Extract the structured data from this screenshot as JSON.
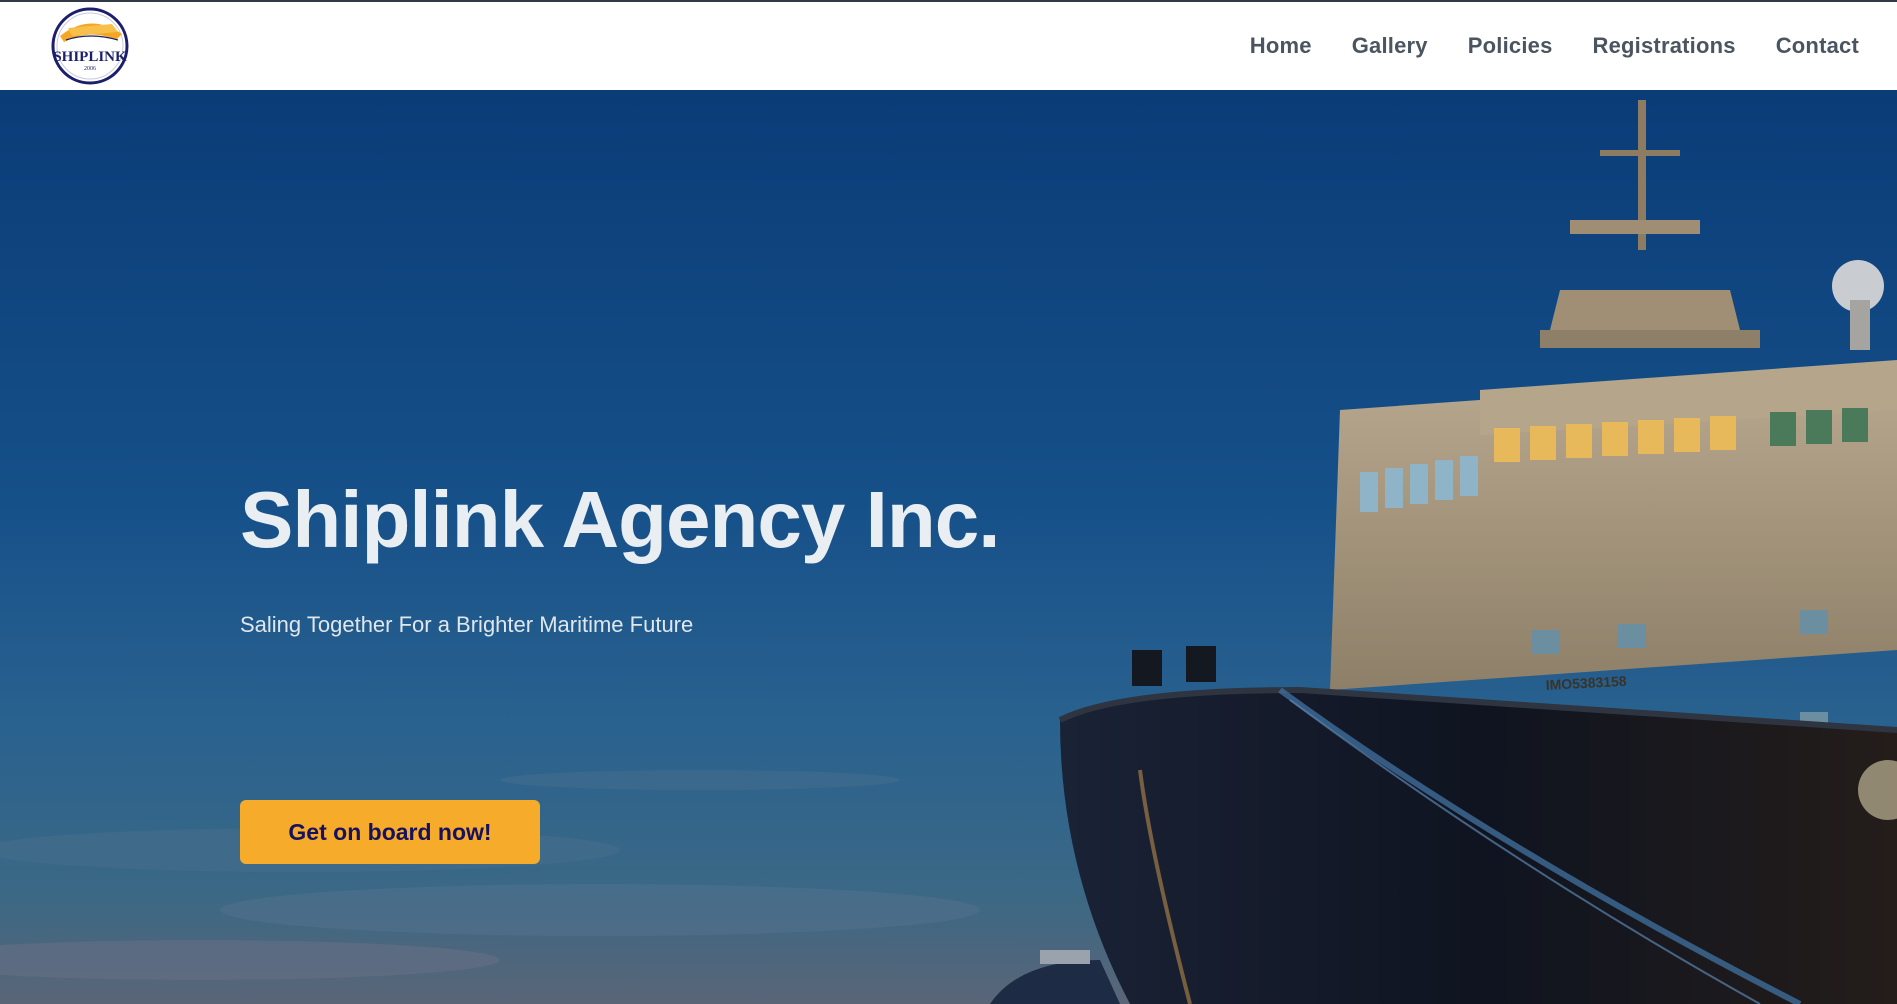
{
  "brand": {
    "logo_text": "SHIPLINK",
    "logo_year": "2006"
  },
  "nav": {
    "items": [
      {
        "label": "Home"
      },
      {
        "label": "Gallery"
      },
      {
        "label": "Policies"
      },
      {
        "label": "Registrations"
      },
      {
        "label": "Contact"
      }
    ]
  },
  "hero": {
    "title": "Shiplink Agency Inc.",
    "subtitle": "Saling Together For a Brighter Maritime Future",
    "cta_label": "Get on board now!",
    "ship_marking": "IMO5383158"
  },
  "colors": {
    "accent": "#f7ab2b",
    "cta_text": "#16125e",
    "nav_text": "#4b5560",
    "sky": "#134c86"
  }
}
